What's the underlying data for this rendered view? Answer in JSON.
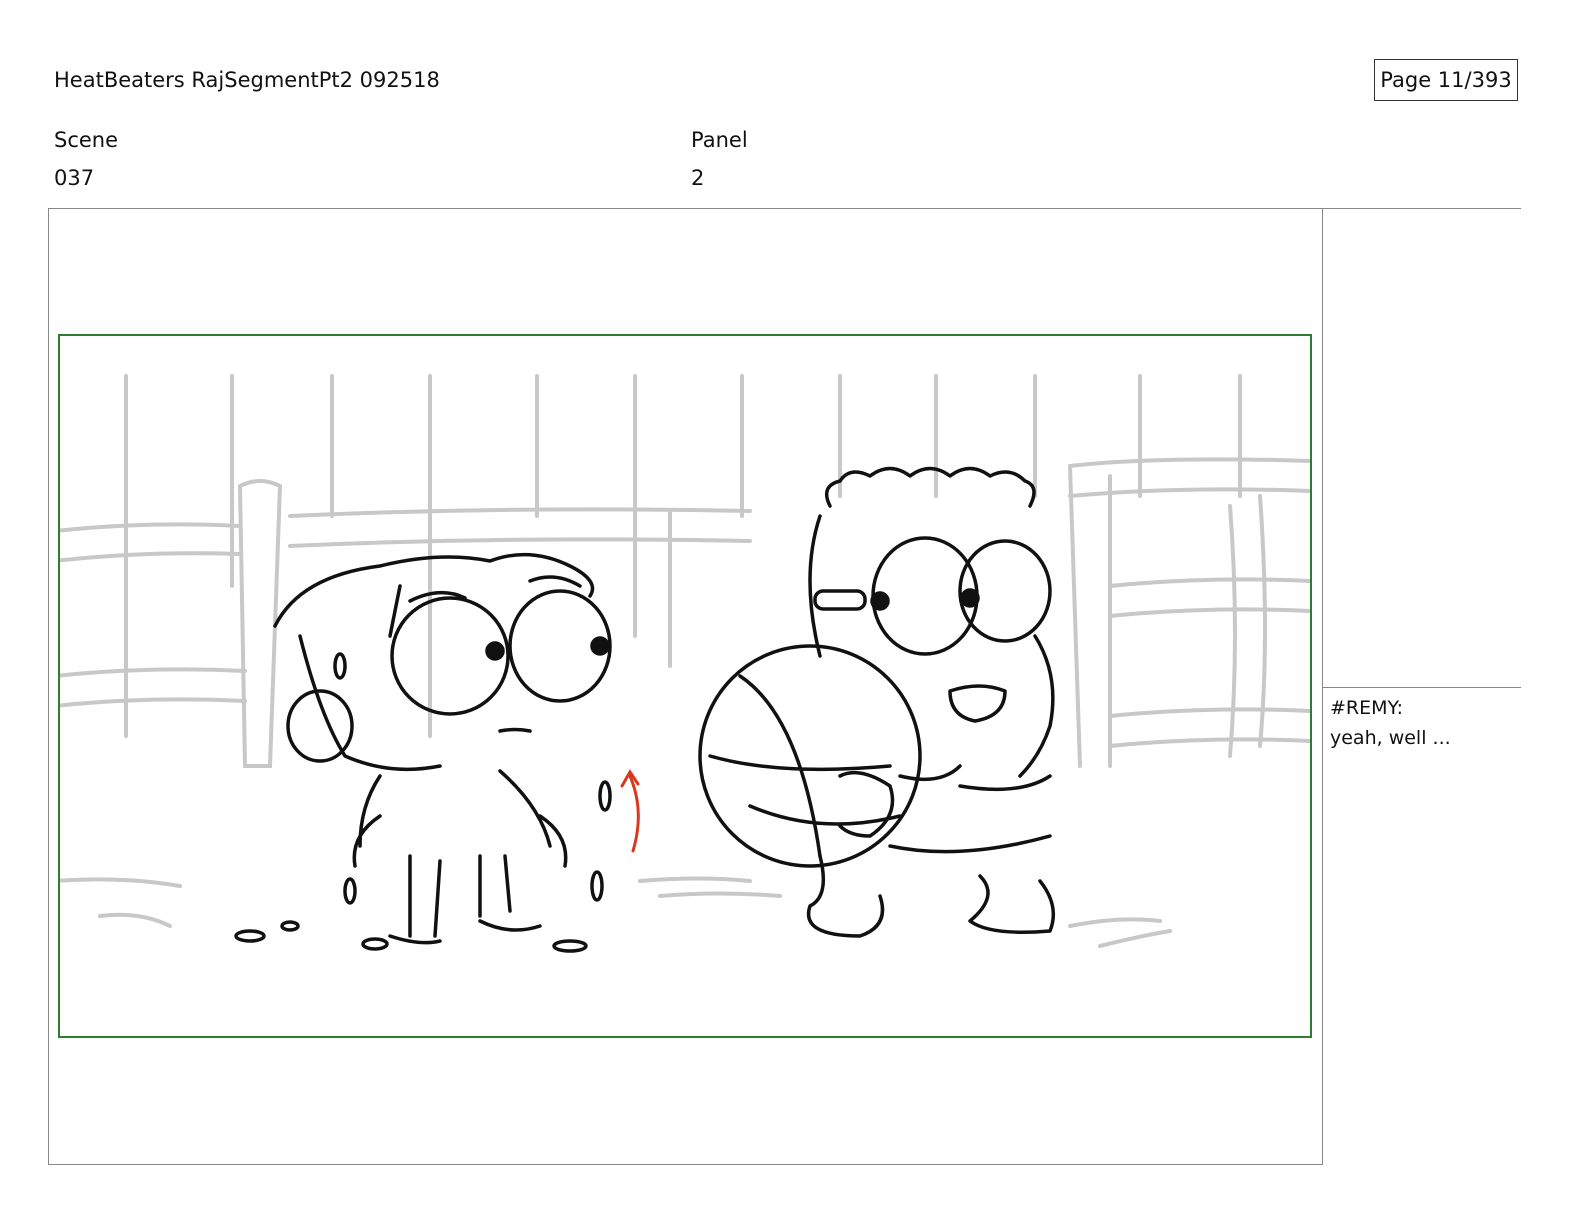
{
  "header": {
    "document_title": "HeatBeaters RajSegmentPt2 092518",
    "page_indicator": "Page  11/393"
  },
  "fields": {
    "scene_label": "Scene",
    "scene_value": "037",
    "panel_label": "Panel",
    "panel_value": "2"
  },
  "notes": {
    "dialogue_speaker": "#REMY:",
    "dialogue_line": "yeah, well ..."
  },
  "colors": {
    "safe_area_border": "#2e7d32",
    "sketch_line": "#111111",
    "background_line": "#c8c8c8",
    "motion_arrow": "#d9381e"
  }
}
